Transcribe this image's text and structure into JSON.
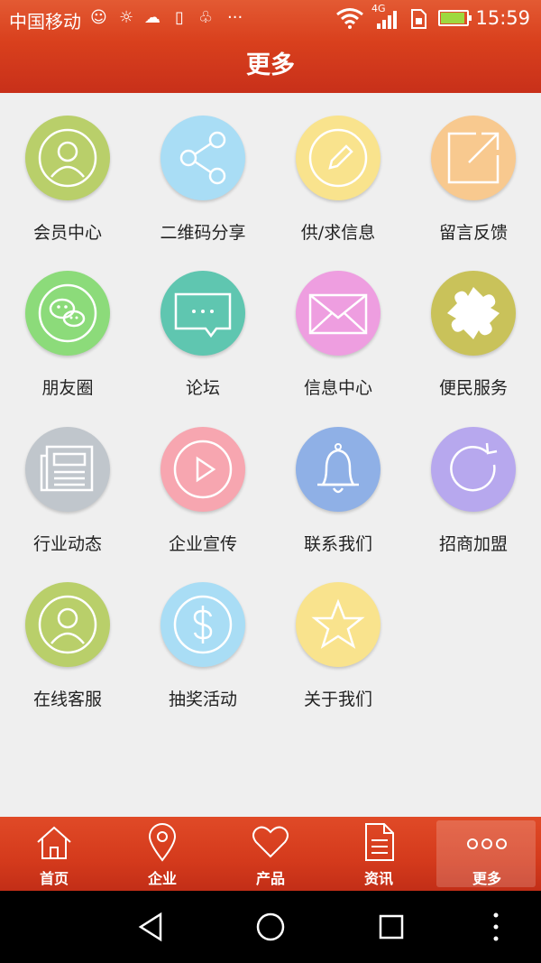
{
  "status_bar": {
    "carrier": "中国移动",
    "network": "4G",
    "time": "15:59",
    "icons": [
      "weibo-icon",
      "brightness-icon",
      "weather-icon",
      "sim-icon",
      "android-icon",
      "more-dots-icon",
      "wifi-icon",
      "signal-icon",
      "sim-card-icon",
      "battery-icon"
    ]
  },
  "header": {
    "title": "更多"
  },
  "menu": [
    {
      "label": "会员中心",
      "icon": "user-icon",
      "color": "#b9cf6a"
    },
    {
      "label": "二维码分享",
      "icon": "share-icon",
      "color": "#a9ddf5"
    },
    {
      "label": "供/求信息",
      "icon": "edit-icon",
      "color": "#f9e38d"
    },
    {
      "label": "留言反馈",
      "icon": "external-link-icon",
      "color": "#f8c98f"
    },
    {
      "label": "朋友圈",
      "icon": "wechat-icon",
      "color": "#8cdb7a"
    },
    {
      "label": "论坛",
      "icon": "chat-bubble-icon",
      "color": "#5fc6b0"
    },
    {
      "label": "信息中心",
      "icon": "mail-icon",
      "color": "#ee9ee0"
    },
    {
      "label": "便民服务",
      "icon": "puzzle-icon",
      "color": "#c9c25a"
    },
    {
      "label": "行业动态",
      "icon": "newspaper-icon",
      "color": "#c0c6cc"
    },
    {
      "label": "企业宣传",
      "icon": "play-icon",
      "color": "#f7a6b0"
    },
    {
      "label": "联系我们",
      "icon": "bell-icon",
      "color": "#8fb0e6"
    },
    {
      "label": "招商加盟",
      "icon": "refresh-icon",
      "color": "#b7a8ee"
    },
    {
      "label": "在线客服",
      "icon": "user-icon",
      "color": "#b9cf6a"
    },
    {
      "label": "抽奖活动",
      "icon": "dollar-icon",
      "color": "#a9ddf5"
    },
    {
      "label": "关于我们",
      "icon": "star-icon",
      "color": "#f9e38d"
    }
  ],
  "tabs": [
    {
      "label": "首页",
      "icon": "home-icon",
      "active": false
    },
    {
      "label": "企业",
      "icon": "location-pin-icon",
      "active": false
    },
    {
      "label": "产品",
      "icon": "heart-icon",
      "active": false
    },
    {
      "label": "资讯",
      "icon": "document-icon",
      "active": false
    },
    {
      "label": "更多",
      "icon": "more-dots-icon",
      "active": true
    }
  ],
  "nav": [
    "back-icon",
    "home-circle-icon",
    "recents-icon",
    "menu-dots-icon"
  ]
}
